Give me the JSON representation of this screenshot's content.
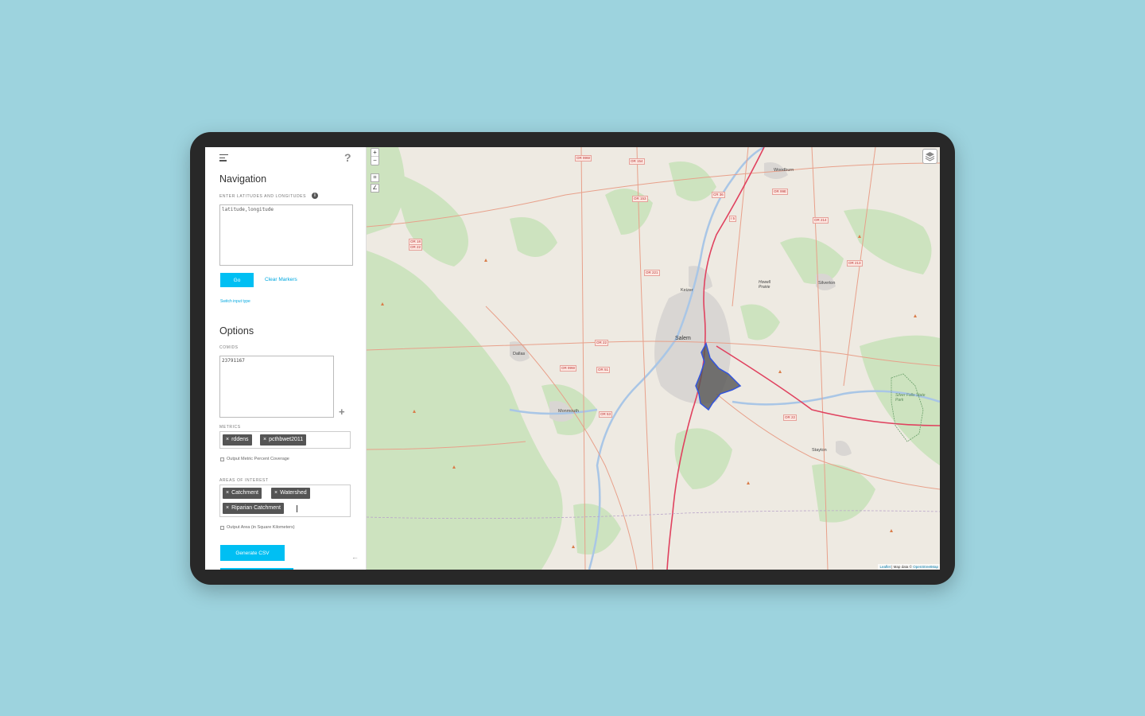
{
  "sidebar": {
    "navigation": {
      "title": "Navigation",
      "coords_label": "ENTER LATITUDES AND LONGITUDES",
      "coords_placeholder": "latitude,longitude",
      "go_label": "Go",
      "clear_label": "Clear Markers",
      "switch_label": "Switch input type"
    },
    "options": {
      "title": "Options",
      "comids_label": "COMIDS",
      "comids_value": "23791167",
      "metrics_label": "METRICS",
      "metrics": [
        "rddens",
        "pcthbwet2011"
      ],
      "metric_coverage_label": "Output Metric Percent Coverage",
      "aoi_label": "AREAS OF INTEREST",
      "aoi": [
        "Catchment",
        "Watershed",
        "Riparian Catchment"
      ],
      "area_label": "Output Area (in Square Kilometers)",
      "generate_label": "Generate CSV"
    }
  },
  "map": {
    "zoom_in": "+",
    "zoom_out": "−",
    "places": {
      "salem": "Salem",
      "keizer": "Keizer",
      "dallas": "Dallas",
      "monmouth": "Monmouth",
      "woodburn": "Woodburn",
      "silverton": "Silverton",
      "stayton": "Stayton",
      "silver_falls": "Silver Falls State Park",
      "howell_prairie": "Howell Prairie"
    },
    "shields": [
      "OR 99W",
      "OR 154",
      "OR 153",
      "OR 221",
      "OR 22",
      "OR 51",
      "OR 99W",
      "OR 18",
      "OR 22",
      "OR 214",
      "OR 213",
      "OR 22",
      "OR 99E",
      "CR 36",
      "OR 53",
      "I 5"
    ],
    "attribution_leaflet": "Leaflet",
    "attribution_sep": " | Map data © ",
    "attribution_osm": "OpenStreetMap"
  },
  "colors": {
    "accent": "#00bff3",
    "tag": "#555555",
    "watershed_fill": "#555555",
    "watershed_stroke": "#3355dd"
  },
  "icons": [
    "menu-icon",
    "help-icon",
    "info-icon",
    "add-icon",
    "close-icon",
    "collapse-arrow-icon",
    "zoom-in-icon",
    "zoom-out-icon",
    "draw-rectangle-icon",
    "draw-polyline-icon",
    "layers-icon"
  ]
}
